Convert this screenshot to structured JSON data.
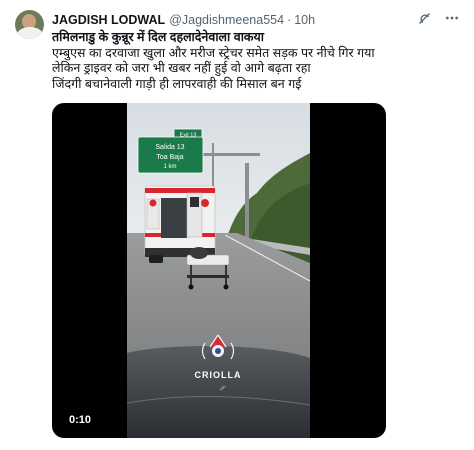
{
  "tweet": {
    "author_name": "JAGDISH LODWAL",
    "handle": "@Jagdishmeena554",
    "separator": "·",
    "time": "10h",
    "lines": [
      "तमिलनाडु के कुन्नूर में दिल दहलादेनेवाला वाकया",
      "एम्बुएस का दरवाजा खुला और मरीज स्ट्रेचर समेत सड़क पर नीचे गिर गया",
      "लेकिन ड्राइवर को जरा भी खबर नहीं हुई वो आगे बढ़ता रहा",
      "जिंदगी बचानेवाली गाड़ी ही लापरवाही की मिसाल बन गई"
    ]
  },
  "actions": {
    "grok_icon": "grok-icon",
    "more_icon": "more-icon"
  },
  "media": {
    "duration": "0:10",
    "watermark_text": "CRIOLLA",
    "sign_exit": "Exit 13",
    "sign_line1": "Salida 13",
    "sign_line2": "Toa Baja",
    "sign_line3": "1 km"
  },
  "colors": {
    "text": "#0f1419",
    "muted": "#536471",
    "sign_green": "#1a7a4a"
  }
}
